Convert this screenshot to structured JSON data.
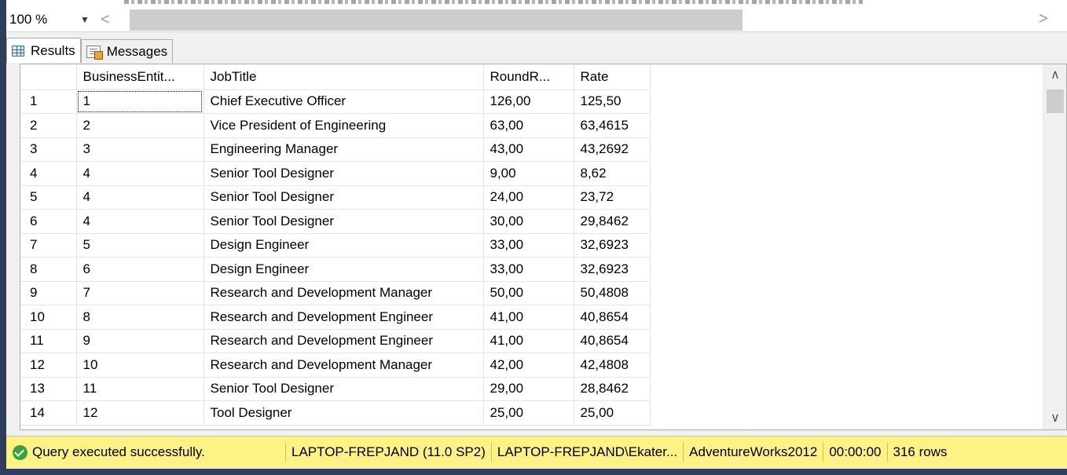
{
  "toolbar": {
    "zoom_value": "100 %",
    "zoom_caret": "▼",
    "hscroll_left": "<",
    "hscroll_right": ">"
  },
  "tabs": [
    {
      "label": "Results",
      "icon": "grid-icon",
      "active": true
    },
    {
      "label": "Messages",
      "icon": "messages-icon",
      "active": false
    }
  ],
  "results": {
    "columns": [
      "",
      "BusinessEntit...",
      "JobTitle",
      "RoundR...",
      "Rate"
    ],
    "rows": [
      [
        "1",
        "1",
        "Chief Executive Officer",
        "126,00",
        "125,50"
      ],
      [
        "2",
        "2",
        "Vice President of Engineering",
        "63,00",
        "63,4615"
      ],
      [
        "3",
        "3",
        "Engineering Manager",
        "43,00",
        "43,2692"
      ],
      [
        "4",
        "4",
        "Senior Tool Designer",
        "9,00",
        "8,62"
      ],
      [
        "5",
        "4",
        "Senior Tool Designer",
        "24,00",
        "23,72"
      ],
      [
        "6",
        "4",
        "Senior Tool Designer",
        "30,00",
        "29,8462"
      ],
      [
        "7",
        "5",
        "Design Engineer",
        "33,00",
        "32,6923"
      ],
      [
        "8",
        "6",
        "Design Engineer",
        "33,00",
        "32,6923"
      ],
      [
        "9",
        "7",
        "Research and Development Manager",
        "50,00",
        "50,4808"
      ],
      [
        "10",
        "8",
        "Research and Development Engineer",
        "41,00",
        "40,8654"
      ],
      [
        "11",
        "9",
        "Research and Development Engineer",
        "41,00",
        "40,8654"
      ],
      [
        "12",
        "10",
        "Research and Development Manager",
        "42,00",
        "42,4808"
      ],
      [
        "13",
        "11",
        "Senior Tool Designer",
        "29,00",
        "28,8462"
      ],
      [
        "14",
        "12",
        "Tool Designer",
        "25,00",
        "25,00"
      ]
    ]
  },
  "scrollbar": {
    "up": "∧",
    "down": "∨"
  },
  "status": {
    "message": "Query executed successfully.",
    "server": "LAPTOP-FREPJAND (11.0 SP2)",
    "user": "LAPTOP-FREPJAND\\Ekater...",
    "database": "AdventureWorks2012",
    "elapsed": "00:00:00",
    "rows": "316 rows",
    "status_color": "#fdf285",
    "ok_color": "#3aa23a"
  }
}
